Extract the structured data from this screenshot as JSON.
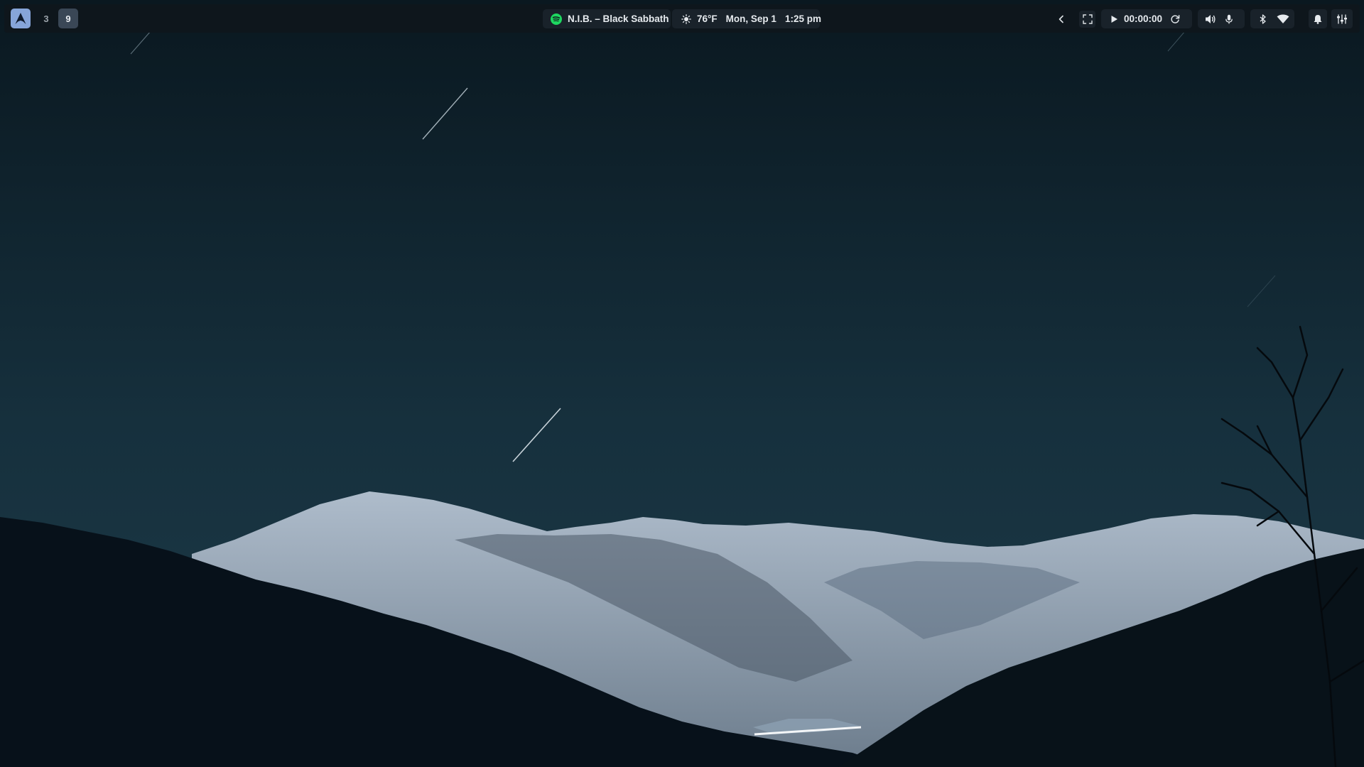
{
  "bar": {
    "workspaces": [
      {
        "label": "",
        "icon": "arch-logo-icon",
        "active": false
      },
      {
        "label": "3",
        "active": false
      },
      {
        "label": "9",
        "active": true
      }
    ],
    "media": {
      "icon": "spotify-icon",
      "track": "N.I.B. – Black Sabbath",
      "accent": "#1ed760"
    },
    "clock": {
      "weather_icon": "sun-icon",
      "temperature": "76°F",
      "date": "Mon, Sep 1",
      "time": "1:25 pm"
    },
    "recorder": {
      "elapsed": "00:00:00"
    },
    "tray_icons": [
      "chevron-left-icon",
      "fullscreen-icon",
      "play-icon",
      "refresh-icon",
      "volume-icon",
      "microphone-icon",
      "bluetooth-icon",
      "wifi-icon",
      "bell-icon",
      "sliders-icon"
    ]
  },
  "theme": {
    "bar_bg": "#0e161c",
    "pill_bg": "#19222a",
    "active_workspace": "#3a4756",
    "logo_bg": "#86a5d9",
    "text": "#e6eaee"
  }
}
